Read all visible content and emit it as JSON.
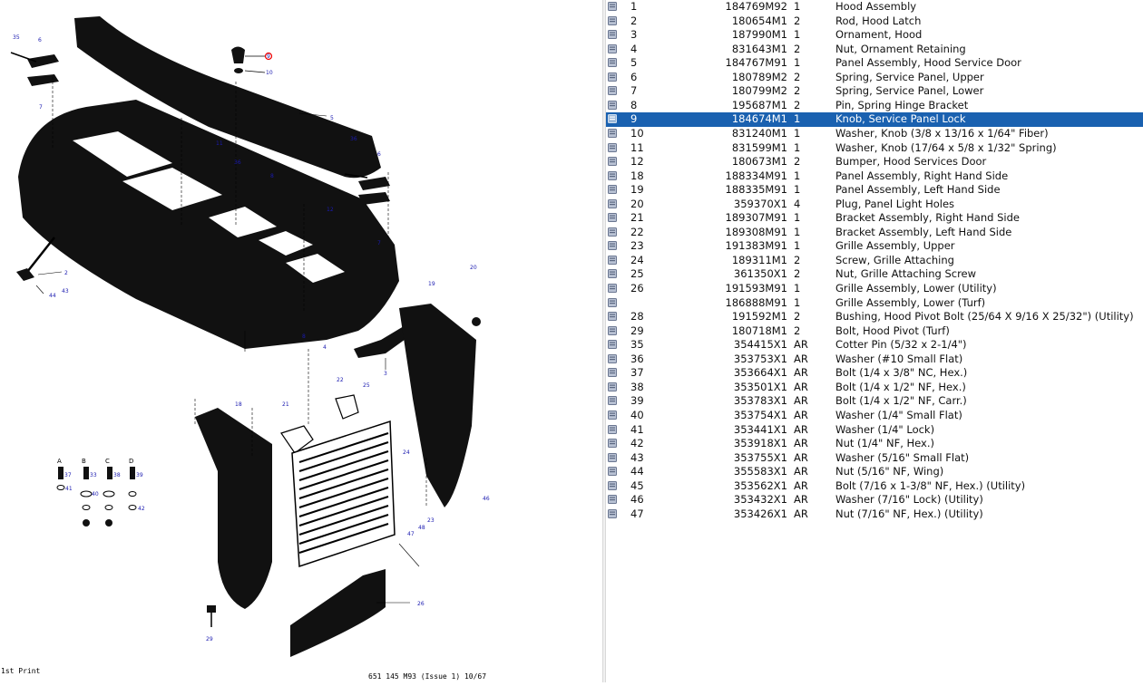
{
  "diagram": {
    "print_label": "1st Print",
    "footer_code": "651 145 M93 (Issue 1) 10/67",
    "callouts": [
      "35",
      "6",
      "7",
      "9",
      "10",
      "11",
      "36",
      "5",
      "8",
      "12",
      "2",
      "44",
      "43",
      "20",
      "19",
      "4",
      "3",
      "22",
      "25",
      "18",
      "21",
      "24",
      "23",
      "48",
      "47",
      "46",
      "26",
      "29",
      "37",
      "33",
      "38",
      "39",
      "40",
      "41",
      "42",
      "36",
      "6",
      "7",
      "8",
      "A",
      "B",
      "C",
      "D"
    ]
  },
  "parts": {
    "selected_ref": "9",
    "selected_color": "#1a61b0",
    "rows": [
      {
        "ref": "1",
        "pn": "184769M92",
        "qty": "1",
        "desc": "Hood Assembly"
      },
      {
        "ref": "2",
        "pn": "180654M1",
        "qty": "2",
        "desc": "Rod, Hood Latch"
      },
      {
        "ref": "3",
        "pn": "187990M1",
        "qty": "1",
        "desc": "Ornament, Hood"
      },
      {
        "ref": "4",
        "pn": "831643M1",
        "qty": "2",
        "desc": "Nut, Ornament Retaining"
      },
      {
        "ref": "5",
        "pn": "184767M91",
        "qty": "1",
        "desc": "Panel Assembly, Hood Service Door"
      },
      {
        "ref": "6",
        "pn": "180789M2",
        "qty": "2",
        "desc": "Spring, Service Panel, Upper"
      },
      {
        "ref": "7",
        "pn": "180799M2",
        "qty": "2",
        "desc": "Spring, Service Panel, Lower"
      },
      {
        "ref": "8",
        "pn": "195687M1",
        "qty": "2",
        "desc": "Pin, Spring Hinge Bracket"
      },
      {
        "ref": "9",
        "pn": "184674M1",
        "qty": "1",
        "desc": "Knob, Service Panel Lock"
      },
      {
        "ref": "10",
        "pn": "831240M1",
        "qty": "1",
        "desc": "Washer, Knob (3/8 x 13/16 x 1/64\" Fiber)"
      },
      {
        "ref": "11",
        "pn": "831599M1",
        "qty": "1",
        "desc": "Washer, Knob (17/64 x 5/8 x 1/32\" Spring)"
      },
      {
        "ref": "12",
        "pn": "180673M1",
        "qty": "2",
        "desc": "Bumper, Hood Services Door"
      },
      {
        "ref": "18",
        "pn": "188334M91",
        "qty": "1",
        "desc": "Panel Assembly, Right Hand Side"
      },
      {
        "ref": "19",
        "pn": "188335M91",
        "qty": "1",
        "desc": "Panel Assembly, Left Hand Side"
      },
      {
        "ref": "20",
        "pn": "359370X1",
        "qty": "4",
        "desc": "Plug, Panel Light Holes"
      },
      {
        "ref": "21",
        "pn": "189307M91",
        "qty": "1",
        "desc": "Bracket Assembly, Right Hand Side"
      },
      {
        "ref": "22",
        "pn": "189308M91",
        "qty": "1",
        "desc": "Bracket Assembly, Left Hand Side"
      },
      {
        "ref": "23",
        "pn": "191383M91",
        "qty": "1",
        "desc": "Grille Assembly, Upper"
      },
      {
        "ref": "24",
        "pn": "189311M1",
        "qty": "2",
        "desc": "Screw, Grille Attaching"
      },
      {
        "ref": "25",
        "pn": "361350X1",
        "qty": "2",
        "desc": "Nut, Grille Attaching Screw"
      },
      {
        "ref": "26",
        "pn": "191593M91",
        "qty": "1",
        "desc": "Grille Assembly, Lower (Utility)"
      },
      {
        "ref": "",
        "pn": "186888M91",
        "qty": "1",
        "desc": "Grille Assembly, Lower (Turf)"
      },
      {
        "ref": "28",
        "pn": "191592M1",
        "qty": "2",
        "desc": "Bushing, Hood Pivot Bolt (25/64 X 9/16 X 25/32\") (Utility)"
      },
      {
        "ref": "29",
        "pn": "180718M1",
        "qty": "2",
        "desc": "Bolt, Hood Pivot (Turf)"
      },
      {
        "ref": "35",
        "pn": "354415X1",
        "qty": "AR",
        "desc": "Cotter Pin (5/32 x 2-1/4\")"
      },
      {
        "ref": "36",
        "pn": "353753X1",
        "qty": "AR",
        "desc": "Washer (#10 Small Flat)"
      },
      {
        "ref": "37",
        "pn": "353664X1",
        "qty": "AR",
        "desc": "Bolt (1/4 x 3/8\" NC, Hex.)"
      },
      {
        "ref": "38",
        "pn": "353501X1",
        "qty": "AR",
        "desc": "Bolt (1/4 x 1/2\" NF, Hex.)"
      },
      {
        "ref": "39",
        "pn": "353783X1",
        "qty": "AR",
        "desc": "Bolt (1/4 x 1/2\" NF, Carr.)"
      },
      {
        "ref": "40",
        "pn": "353754X1",
        "qty": "AR",
        "desc": "Washer (1/4\" Small Flat)"
      },
      {
        "ref": "41",
        "pn": "353441X1",
        "qty": "AR",
        "desc": "Washer (1/4\" Lock)"
      },
      {
        "ref": "42",
        "pn": "353918X1",
        "qty": "AR",
        "desc": "Nut (1/4\" NF, Hex.)"
      },
      {
        "ref": "43",
        "pn": "353755X1",
        "qty": "AR",
        "desc": "Washer (5/16\" Small Flat)"
      },
      {
        "ref": "44",
        "pn": "355583X1",
        "qty": "AR",
        "desc": "Nut (5/16\" NF, Wing)"
      },
      {
        "ref": "45",
        "pn": "353562X1",
        "qty": "AR",
        "desc": "Bolt (7/16 x 1-3/8\" NF, Hex.) (Utility)"
      },
      {
        "ref": "46",
        "pn": "353432X1",
        "qty": "AR",
        "desc": "Washer (7/16\" Lock) (Utility)"
      },
      {
        "ref": "47",
        "pn": "353426X1",
        "qty": "AR",
        "desc": "Nut (7/16\" NF, Hex.) (Utility)"
      }
    ]
  }
}
